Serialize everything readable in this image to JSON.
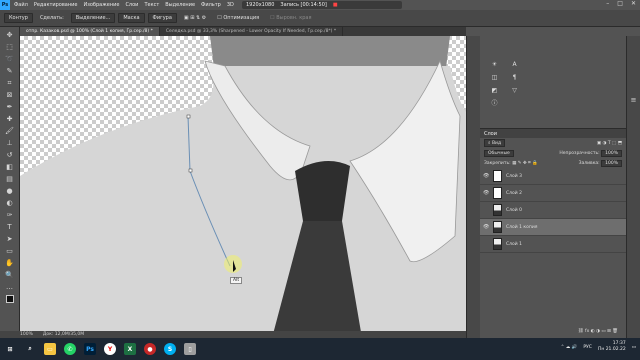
{
  "app": {
    "logo": "Ps"
  },
  "menu": [
    "Файл",
    "Редактирование",
    "Изображение",
    "Слои",
    "Текст",
    "Выделение",
    "Фильтр",
    "3D"
  ],
  "recorder": {
    "resolution": "1920x1080",
    "label": "Запись [00:14:50]"
  },
  "options": {
    "mode": "Контур",
    "make_label": "Сделать:",
    "selection": "Выделение...",
    "mask": "Маска",
    "shape": "Фигура",
    "optimize": "Оптимизация",
    "align_edges": "Выровн. края"
  },
  "tabs": [
    {
      "label": "отпр. Казаков.psd @ 100% (Слой 1 копия, Гр.сер./8) *",
      "active": true
    },
    {
      "label": "Селедка.psd @ 33,3% (Sharpened - Lower Opacity If Needed, Гр.сер./8*) *",
      "active": false
    }
  ],
  "tools": [
    "move-icon",
    "marquee-icon",
    "lasso-icon",
    "quick-select-icon",
    "crop-icon",
    "frame-icon",
    "eyedropper-icon",
    "healing-icon",
    "brush-icon",
    "stamp-icon",
    "history-brush-icon",
    "eraser-icon",
    "gradient-icon",
    "blur-icon",
    "dodge-icon",
    "pen-icon",
    "type-icon",
    "path-select-icon",
    "rectangle-icon",
    "hand-icon",
    "zoom-icon"
  ],
  "canvas": {
    "tooltip": "Alt"
  },
  "status": {
    "zoom": "100%",
    "doc": "Док: 12,0M/35,0M"
  },
  "layers": {
    "title": "Слои",
    "kind_filter": "Вид",
    "blend_mode": "Обычные",
    "opacity_label": "Непрозрачность:",
    "opacity_value": "100%",
    "lock_label": "Закрепить:",
    "fill_label": "Заливка:",
    "fill_value": "100%",
    "items": [
      {
        "name": "Слой 3",
        "visible": true,
        "thumb": "white",
        "selected": false
      },
      {
        "name": "Слой 2",
        "visible": true,
        "thumb": "white",
        "selected": false
      },
      {
        "name": "Слой 0",
        "visible": false,
        "thumb": "photo",
        "selected": false
      },
      {
        "name": "Слой 1 копия",
        "visible": true,
        "thumb": "photo",
        "selected": true
      },
      {
        "name": "Слой 1",
        "visible": false,
        "thumb": "photo",
        "selected": false
      }
    ]
  },
  "taskbar": {
    "apps": [
      "start-icon",
      "search-icon",
      "explorer-icon",
      "whatsapp-icon",
      "photoshop-icon",
      "yandex-icon",
      "excel-icon",
      "record-icon",
      "skype-icon",
      "file-icon"
    ],
    "lang": "РУС",
    "time": "17:37",
    "date": "Пн 21.02.22"
  }
}
